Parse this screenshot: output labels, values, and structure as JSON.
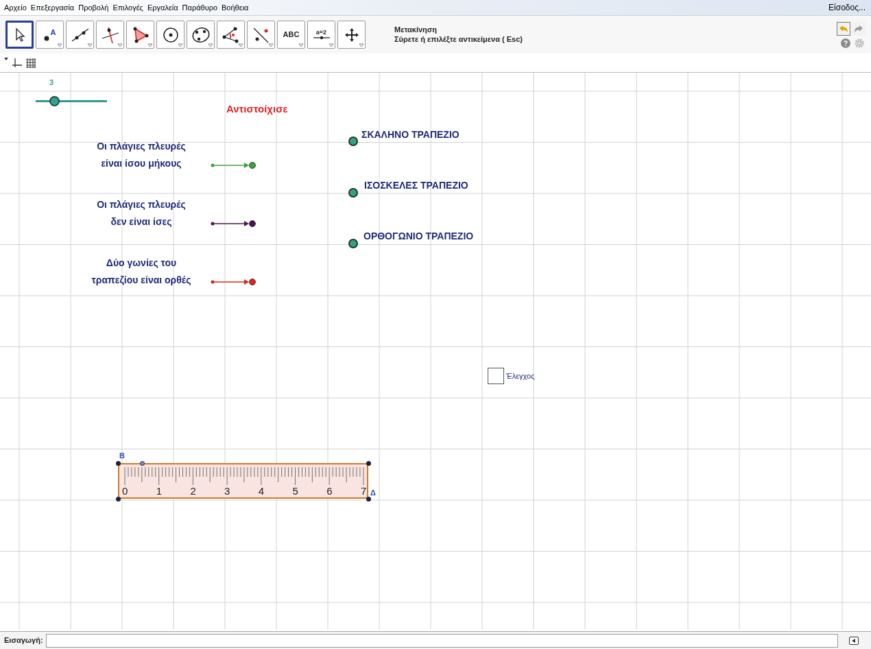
{
  "menu": [
    "Αρχείο",
    "Επεξεργασία",
    "Προβολή",
    "Επιλογές",
    "Εργαλεία",
    "Παράθυρο",
    "Βοήθεια"
  ],
  "login": "Είσοδος...",
  "tools": [
    {
      "kind": "move",
      "selected": true
    },
    {
      "kind": "point",
      "label": "A",
      "selected": false
    },
    {
      "kind": "line",
      "selected": false
    },
    {
      "kind": "perpendicular",
      "selected": false
    },
    {
      "kind": "polygon",
      "selected": false
    },
    {
      "kind": "circle",
      "selected": false
    },
    {
      "kind": "conic",
      "selected": false
    },
    {
      "kind": "angle",
      "selected": false
    },
    {
      "kind": "reflect",
      "selected": false
    },
    {
      "kind": "text",
      "label": "ABC",
      "selected": false
    },
    {
      "kind": "slider",
      "label": "a=2",
      "selected": false
    },
    {
      "kind": "pan",
      "selected": false
    }
  ],
  "tool_info": {
    "title": "Μετακίνηση",
    "help": "Σύρετε ή επιλέξτε αντικείμενα ( Esc)"
  },
  "canvas": {
    "slider": {
      "label": "3",
      "level": 0.26
    },
    "heading": "Αντιστοίχισε",
    "statements": [
      {
        "lines": [
          "Οι πλάγιες πλευρές",
          "είναι ίσου μήκους"
        ],
        "color": "#3fa33a"
      },
      {
        "lines": [
          "Οι πλάγιες πλευρές",
          "δεν είναι ίσες"
        ],
        "color": "#4a1650"
      },
      {
        "lines": [
          "Δύο γωνίες του",
          "τραπεζίου είναι ορθές"
        ],
        "color": "#d8281c"
      }
    ],
    "shapes": [
      "ΣΚΑΛΗΝΟ ΤΡΑΠΕΖΙΟ",
      "ΙΣΟΣΚΕΛΕΣ ΤΡΑΠΕΖΙΟ",
      "ΟΡΘΟΓΩΝΙΟ ΤΡΑΠΕΖΙΟ"
    ],
    "checkbox": {
      "label": "Έλεγχος",
      "checked": false
    },
    "ruler": {
      "numbers": [
        "0",
        "1",
        "2",
        "3",
        "4",
        "5",
        "6",
        "7"
      ],
      "top_label": "B",
      "right_label": "Δ"
    }
  },
  "input_bar": {
    "label": "Εισαγωγή:"
  }
}
